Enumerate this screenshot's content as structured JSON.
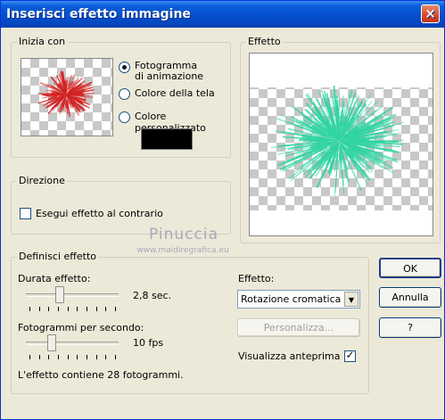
{
  "window": {
    "title": "Inserisci effetto immagine",
    "close_glyph": "×"
  },
  "start_group": {
    "label": "Inizia con",
    "options": [
      {
        "label": "Fotogramma\ndi animazione",
        "checked": true
      },
      {
        "label": "Colore della tela",
        "checked": false
      },
      {
        "label": "Colore personalizzato",
        "checked": false
      }
    ],
    "custom_color": "#000000"
  },
  "direction_group": {
    "label": "Direzione",
    "reverse_label": "Esegui effetto al contrario",
    "reverse_checked": false
  },
  "preview_group": {
    "label": "Effetto"
  },
  "watermark": {
    "line1": "Pinuccia",
    "line2": "www.maidiregrafica.eu"
  },
  "define_group": {
    "label": "Definisci effetto",
    "duration_label": "Durata effetto:",
    "duration_value": "2,8 sec.",
    "duration_fraction": 0.35,
    "fps_label": "Fotogrammi per secondo:",
    "fps_value": "10 fps",
    "fps_fraction": 0.26,
    "effect_label": "Effetto:",
    "effect_selected": "Rotazione cromatica",
    "customize_label": "Personalizza...",
    "preview_label": "Visualizza anteprima",
    "preview_checked": true,
    "summary": "L'effetto contiene 28 fotogrammi."
  },
  "buttons": {
    "ok": "OK",
    "cancel": "Annulla",
    "help": "?"
  },
  "colors": {
    "start_art": "#d42020",
    "effect_art": "#2fd5a2"
  }
}
